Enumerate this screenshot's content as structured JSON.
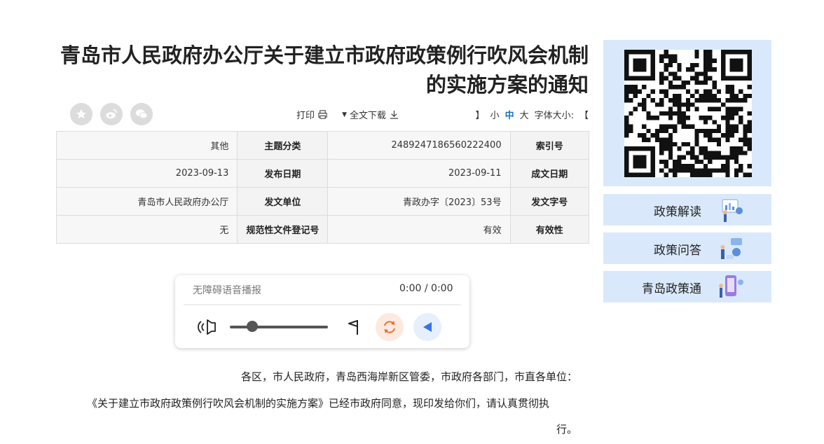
{
  "article": {
    "title": "青岛市人民政府办公厅关于建立市政府政策例行吹风会机制的实施方案的通知"
  },
  "toolbar": {
    "font_size_open": "【",
    "font_size_label": "字体大小:",
    "font_size_large": "大",
    "font_size_medium": "中",
    "font_size_small": "小",
    "font_size_close": "】",
    "download_label": "全文下载",
    "print_label": "打印",
    "share_icons": [
      "wechat-icon",
      "weibo-icon",
      "favorite-icon"
    ]
  },
  "meta": {
    "rows": [
      [
        {
          "label": "索引号",
          "value": "2489247186560222400"
        },
        {
          "label": "主题分类",
          "value": "其他"
        }
      ],
      [
        {
          "label": "成文日期",
          "value": "2023-09-11"
        },
        {
          "label": "发布日期",
          "value": "2023-09-13"
        }
      ],
      [
        {
          "label": "发文字号",
          "value": "青政办字〔2023〕53号"
        },
        {
          "label": "发文单位",
          "value": "青岛市人民政府办公厅"
        }
      ],
      [
        {
          "label": "有效性",
          "value": "有效"
        },
        {
          "label": "规范性文件登记号",
          "value": "无"
        }
      ]
    ]
  },
  "player": {
    "time": "0:00 / 0:00",
    "title": "无障碍语音播报",
    "progress_percent": 0,
    "volume_fraction": 0.2
  },
  "body": {
    "p1": "各区，市人民政府，青岛西海岸新区管委，市政府各部门，市直各单位：",
    "p2": "《关于建立市政府政策例行吹风会机制的实施方案》已经市政府同意，现印发给你们，请认真贯彻执",
    "p3": "行。"
  },
  "sidebar": {
    "buttons": [
      {
        "label": "政策解读"
      },
      {
        "label": "政策问答"
      },
      {
        "label": "青岛政策通"
      }
    ]
  },
  "colors": {
    "accent": "#1a6fc9",
    "sidebar_bg": "#d9e9fb",
    "play_bg": "#e6effc",
    "refresh_bg": "#fde9df",
    "refresh_fg": "#f26b2e"
  }
}
